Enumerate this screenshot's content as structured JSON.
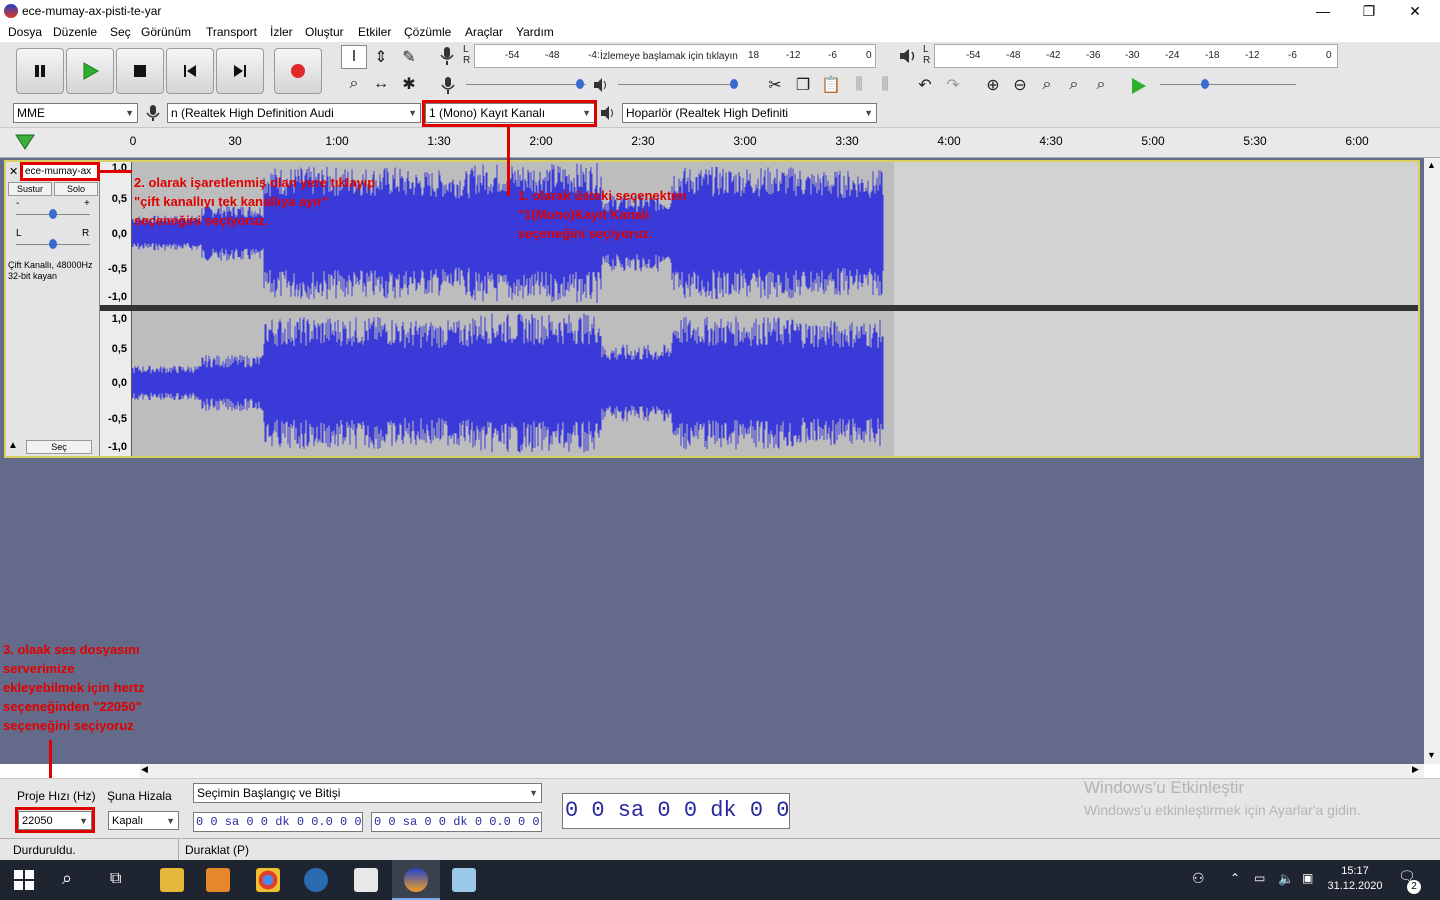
{
  "window": {
    "title": "ece-mumay-ax-pisti-te-yar",
    "min": "—",
    "max": "❐",
    "close": "✕"
  },
  "menu": [
    "Dosya",
    "Düzenle",
    "Seç",
    "Görünüm",
    "Transport",
    "İzler",
    "Oluştur",
    "Etkiler",
    "Çözümle",
    "Araçlar",
    "Yardım"
  ],
  "meter": {
    "rec_ticks": [
      "-54",
      "-48",
      "-4:",
      "18",
      "-12",
      "-6",
      "0"
    ],
    "rec_hint": "İzlemeye başlamak için tıklayın",
    "play_ticks": [
      "-54",
      "-48",
      "-42",
      "-36",
      "-30",
      "-24",
      "-18",
      "-12",
      "-6",
      "0"
    ],
    "lr": [
      "L",
      "R"
    ]
  },
  "devices": {
    "host": "MME",
    "input": "n (Realtek High Definition Audi",
    "channels": "1 (Mono) Kayıt Kanalı",
    "output": "Hoparlör (Realtek High Definiti"
  },
  "ruler": [
    "0",
    "30",
    "1:00",
    "1:30",
    "2:00",
    "2:30",
    "3:00",
    "3:30",
    "4:00",
    "4:30",
    "5:00",
    "5:30",
    "6:00"
  ],
  "track": {
    "name": "ece-mumay-ax",
    "mute": "Sustur",
    "solo": "Solo",
    "pan_l": "L",
    "pan_r": "R",
    "gain_minus": "-",
    "gain_plus": "+",
    "info1": "Çift Kanallı, 48000Hz",
    "info2": "32-bit kayan",
    "select": "Seç",
    "scale": [
      "1,0",
      "0,5",
      "0,0",
      "-0,5",
      "-1,0"
    ]
  },
  "annotations": {
    "a1": "1. olarak  üsteki seçenekten\n\"1(Mono)Kayıt Kanalı\nseçeneğini seçiyoruz.",
    "a2": "2. olarak işaretlenmiş olan yere tıklayıp\n\"çift kanallıyı tek kanallıya ayır\"\nseçeneğini seçiyoruz.",
    "a3": "3. olaak ses dosyasını\nserverimize\nekleyebilmek için hertz\nseçeneğinden \"22050\"\nseçeneğini seçiyoruz"
  },
  "selection": {
    "rate_label": "Proje Hızı (Hz)",
    "rate_value": "22050",
    "snap_label": "Şuna Hizala",
    "snap_value": "Kapalı",
    "sel_mode": "Seçimin Başlangıç ve Bitişi",
    "time1": "0 0 sa 0 0 dk 0 0.0 0 0 sn",
    "time2": "0 0 sa 0 0 dk 0 0.0 0 0 sn",
    "big_time": "0 0 sa 0 0 dk 0 0 sn"
  },
  "status": {
    "left": "Durduruldu.",
    "right": "Duraklat (P)"
  },
  "watermark": {
    "line1": "Windows'u Etkinleştir",
    "line2": "Windows'u etkinleştirmek için Ayarlar'a gidin."
  },
  "tray": {
    "time": "15:17",
    "date": "31.12.2020",
    "notif": "2"
  }
}
